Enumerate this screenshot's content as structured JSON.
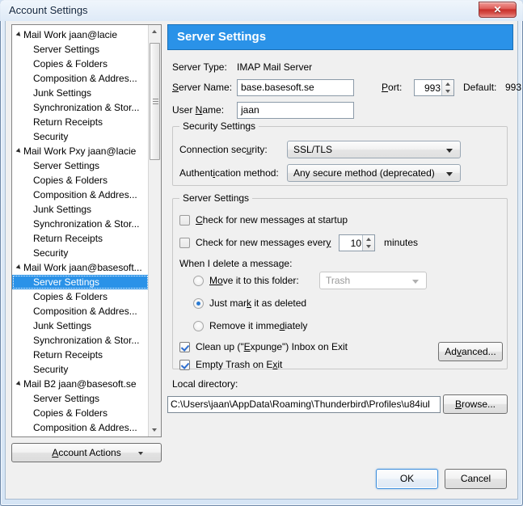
{
  "window": {
    "title": "Account Settings",
    "close_label": "✕"
  },
  "tree": {
    "items": [
      {
        "label": "Mail Work jaan@lacie",
        "type": "account",
        "selected": false
      },
      {
        "label": "Server Settings",
        "type": "child",
        "selected": false
      },
      {
        "label": "Copies & Folders",
        "type": "child",
        "selected": false
      },
      {
        "label": "Composition & Addres...",
        "type": "child",
        "selected": false
      },
      {
        "label": "Junk Settings",
        "type": "child",
        "selected": false
      },
      {
        "label": "Synchronization & Stor...",
        "type": "child",
        "selected": false
      },
      {
        "label": "Return Receipts",
        "type": "child",
        "selected": false
      },
      {
        "label": "Security",
        "type": "child",
        "selected": false
      },
      {
        "label": "Mail Work Pxy jaan@lacie",
        "type": "account",
        "selected": false
      },
      {
        "label": "Server Settings",
        "type": "child",
        "selected": false
      },
      {
        "label": "Copies & Folders",
        "type": "child",
        "selected": false
      },
      {
        "label": "Composition & Addres...",
        "type": "child",
        "selected": false
      },
      {
        "label": "Junk Settings",
        "type": "child",
        "selected": false
      },
      {
        "label": "Synchronization & Stor...",
        "type": "child",
        "selected": false
      },
      {
        "label": "Return Receipts",
        "type": "child",
        "selected": false
      },
      {
        "label": "Security",
        "type": "child",
        "selected": false
      },
      {
        "label": "Mail Work jaan@basesoft...",
        "type": "account",
        "selected": false
      },
      {
        "label": "Server Settings",
        "type": "child",
        "selected": true
      },
      {
        "label": "Copies & Folders",
        "type": "child",
        "selected": false
      },
      {
        "label": "Composition & Addres...",
        "type": "child",
        "selected": false
      },
      {
        "label": "Junk Settings",
        "type": "child",
        "selected": false
      },
      {
        "label": "Synchronization & Stor...",
        "type": "child",
        "selected": false
      },
      {
        "label": "Return Receipts",
        "type": "child",
        "selected": false
      },
      {
        "label": "Security",
        "type": "child",
        "selected": false
      },
      {
        "label": "Mail B2 jaan@basesoft.se",
        "type": "account",
        "selected": false
      },
      {
        "label": "Server Settings",
        "type": "child",
        "selected": false
      },
      {
        "label": "Copies & Folders",
        "type": "child",
        "selected": false
      },
      {
        "label": "Composition & Addres...",
        "type": "child",
        "selected": false
      }
    ]
  },
  "account_actions": {
    "label_pre": "A",
    "label_post": "ccount Actions"
  },
  "pane": {
    "header": "Server Settings",
    "server_type_label": "Server Type:",
    "server_type_value": "IMAP Mail Server",
    "server_name_label_pre": "S",
    "server_name_label_post": "erver Name:",
    "server_name_value": "base.basesoft.se",
    "port_label_pre": "P",
    "port_label_post": "ort:",
    "port_value": "993",
    "default_label": "Default:",
    "default_value": "993",
    "user_name_label_pre": "User ",
    "user_name_label_mid": "N",
    "user_name_label_post": "ame:",
    "user_name_value": "jaan"
  },
  "security": {
    "group_title": "Security Settings",
    "connection_label_pre": "Connection sec",
    "connection_label_mid": "u",
    "connection_label_post": "rity:",
    "connection_value": "SSL/TLS",
    "auth_label_pre": "Authent",
    "auth_label_mid": "i",
    "auth_label_post": "cation method:",
    "auth_value": "Any secure method (deprecated)"
  },
  "server_settings": {
    "group_title": "Server Settings",
    "check_startup_pre": "",
    "check_startup_mid": "C",
    "check_startup_post": "heck for new messages at startup",
    "check_startup_checked": false,
    "check_every_pre": "Check for new messages ever",
    "check_every_mid": "y",
    "check_every_post": "",
    "check_every_checked": false,
    "interval_value": "10",
    "minutes_label": "minutes",
    "delete_label": "When I delete a message:",
    "radio_move_pre": "M",
    "radio_move_mid": "o",
    "radio_move_post": "ve it to this folder:",
    "radio_move_selected": false,
    "folder_value": "Trash",
    "folder_disabled": true,
    "radio_mark_pre": "Just mar",
    "radio_mark_mid": "k",
    "radio_mark_post": " it as deleted",
    "radio_mark_selected": true,
    "radio_remove_pre": "Remove it imme",
    "radio_remove_mid": "d",
    "radio_remove_post": "iately",
    "radio_remove_selected": false,
    "expunge_pre": "Clean up (\"",
    "expunge_mid": "E",
    "expunge_post": "xpunge\") Inbox on Exit",
    "expunge_checked": true,
    "empty_trash_pre": "Empty Trash on E",
    "empty_trash_mid": "x",
    "empty_trash_post": "it",
    "empty_trash_checked": true,
    "advanced_pre": "Ad",
    "advanced_mid": "v",
    "advanced_post": "anced..."
  },
  "local": {
    "label": "Local directory:",
    "path": "C:\\Users\\jaan\\AppData\\Roaming\\Thunderbird\\Profiles\\u84iul",
    "browse_pre": "",
    "browse_mid": "B",
    "browse_post": "rowse..."
  },
  "footer": {
    "ok": "OK",
    "cancel": "Cancel"
  },
  "colors": {
    "accent": "#2a92e8",
    "dialog_bg": "#f0f0f0",
    "close_red": "#c8302b"
  }
}
